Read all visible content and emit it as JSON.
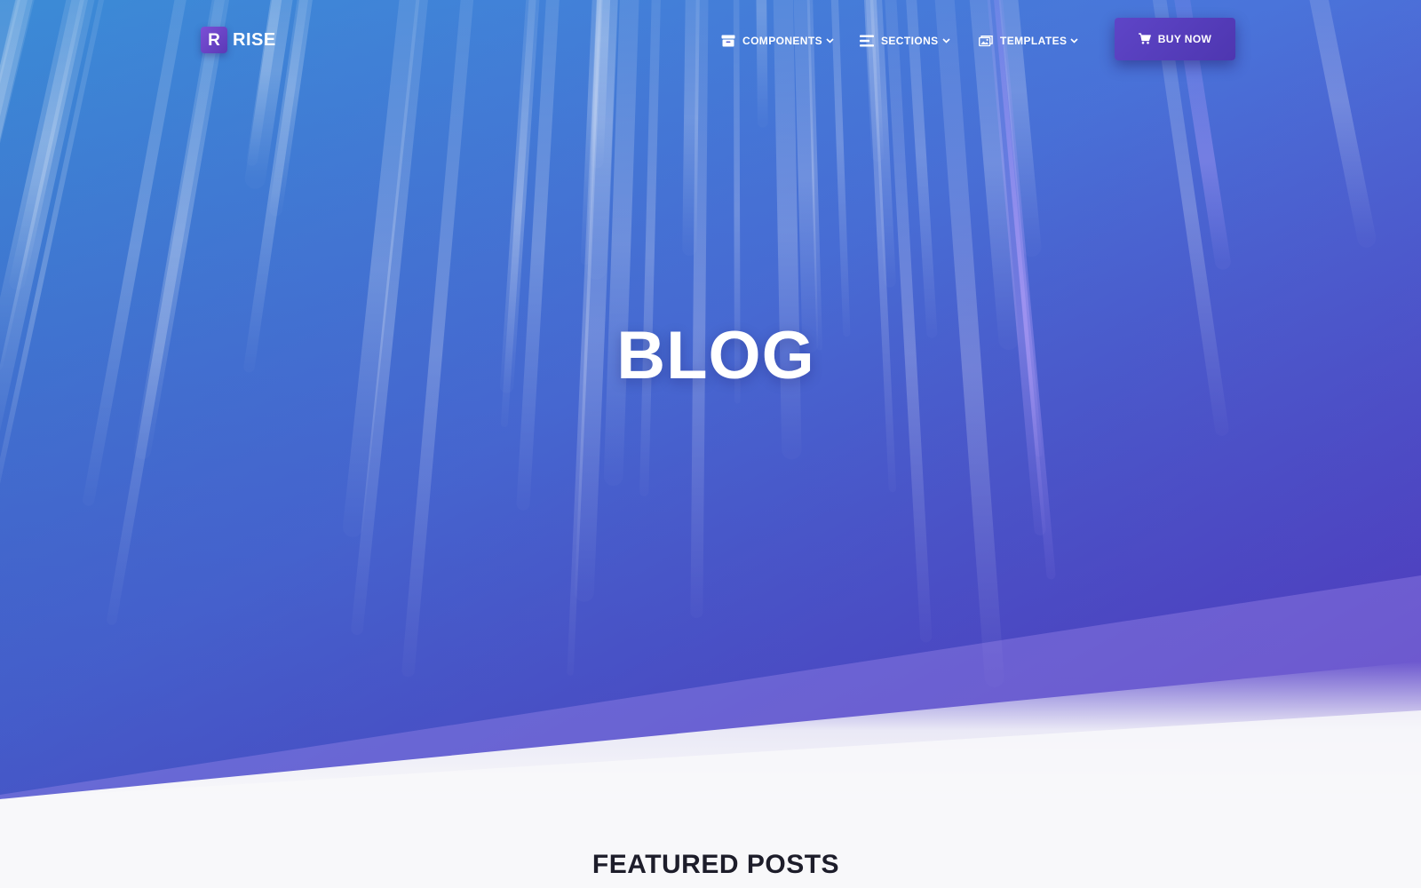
{
  "brand": {
    "logo_letter": "R",
    "name": "RISE"
  },
  "nav": {
    "items": [
      {
        "label": "COMPONENTS",
        "icon": "archive-box-icon"
      },
      {
        "label": "SECTIONS",
        "icon": "list-icon"
      },
      {
        "label": "TEMPLATES",
        "icon": "images-icon"
      }
    ],
    "cta_label": "BUY NOW",
    "cta_icon": "shopping-cart-icon"
  },
  "hero": {
    "title": "BLOG"
  },
  "featured": {
    "title": "FEATURED POSTS"
  },
  "colors": {
    "hero_gradient_start": "#3d8fd8",
    "hero_gradient_end": "#5a3fc7",
    "accent": "#5e45c7",
    "page_background": "#f8f8fa",
    "heading_text": "#1d1d2a"
  }
}
